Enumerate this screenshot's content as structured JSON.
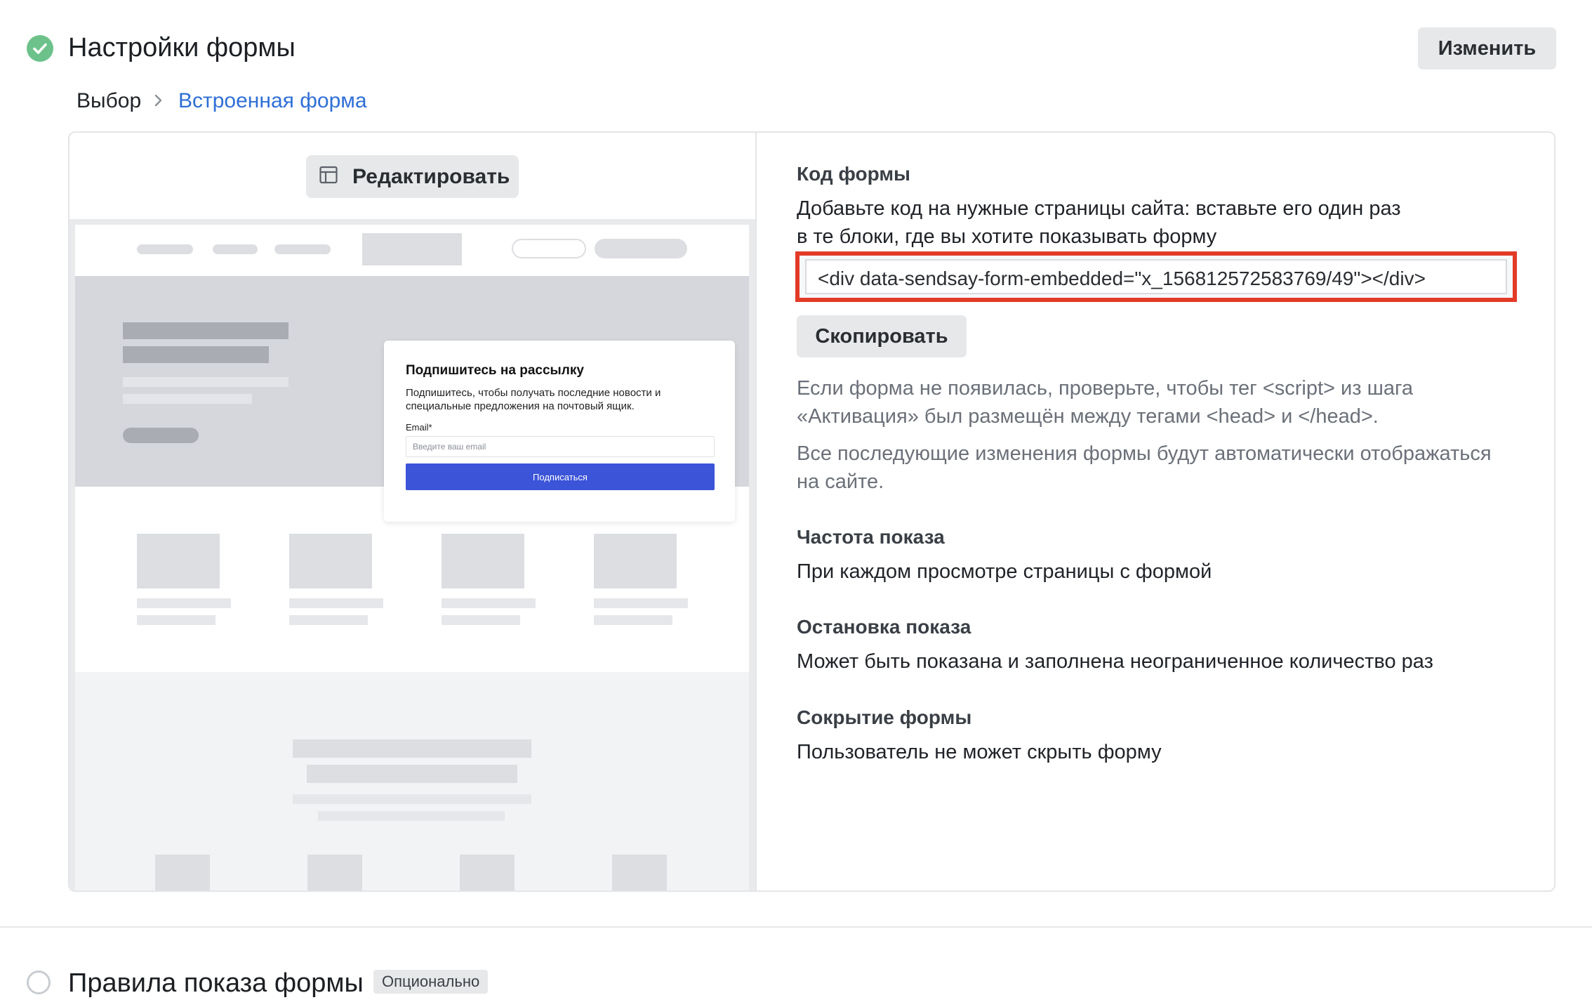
{
  "header": {
    "title": "Настройки формы",
    "edit_label": "Изменить"
  },
  "breadcrumb": {
    "items": [
      "Выбор",
      "Встроенная форма"
    ]
  },
  "preview": {
    "edit_label": "Редактировать",
    "subscribe_card": {
      "title": "Подпишитесь на рассылку",
      "description": "Подпишитесь, чтобы получать последние новости и специальные предложения на почтовый ящик.",
      "email_label": "Email*",
      "email_placeholder": "Введите ваш email",
      "button_label": "Подписаться"
    }
  },
  "form_code": {
    "heading": "Код формы",
    "line1": "Добавьте код на нужные страницы сайта: вставьте его один раз",
    "line2": "в те блоки, где вы хотите показывать форму",
    "code": "<div data-sendsay-form-embedded=\"x_156812572583769/49\"></div>",
    "copy_label": "Скопировать",
    "note1_line1": "Если форма не появилась, проверьте, чтобы тег <script> из шага",
    "note1_line2": "«Активация» был размещён между тегами <head> и </head>.",
    "note2_line1": "Все последующие изменения формы будут автоматически отображаться",
    "note2_line2": "на сайте."
  },
  "frequency": {
    "heading": "Частота показа",
    "value": "При каждом просмотре страницы с формой"
  },
  "stop": {
    "heading": "Остановка показа",
    "value": "Может быть показана и заполнена неограниченное количество раз"
  },
  "hide": {
    "heading": "Сокрытие формы",
    "value": "Пользователь не может скрыть форму"
  },
  "next_section": {
    "title": "Правила показа формы",
    "badge": "Опционально"
  },
  "colors": {
    "accent": "#2f6fd6",
    "success": "#6cc28a",
    "highlight": "#e23b27",
    "subscribe_button": "#3b54d8"
  }
}
